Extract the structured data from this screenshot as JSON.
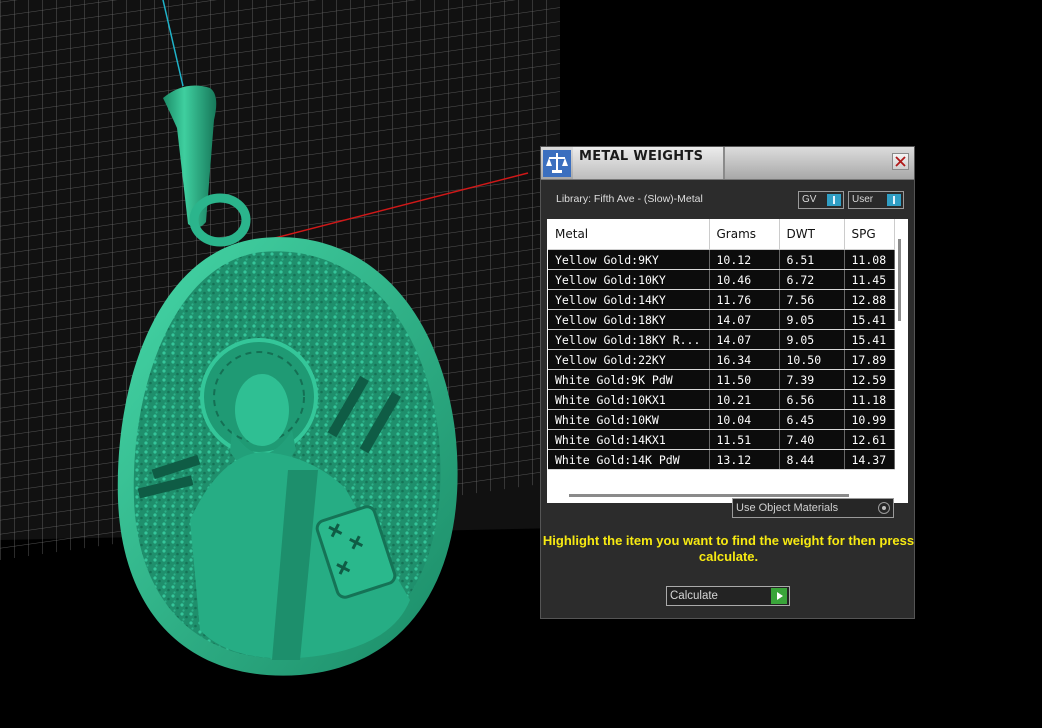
{
  "panel": {
    "title": "METAL WEIGHTS",
    "library_label": "Library: Fifth Ave - (Slow)-Metal",
    "toggles": {
      "gv": "GV",
      "user": "User"
    },
    "use_object_materials": "Use Object Materials",
    "instruction": "Highlight the item you want to find the weight for then press calculate.",
    "calculate": "Calculate"
  },
  "table": {
    "columns": [
      "Metal",
      "Grams",
      "DWT",
      "SPG"
    ],
    "rows": [
      [
        "Yellow Gold:9KY",
        "10.12",
        "6.51",
        "11.08"
      ],
      [
        "Yellow Gold:10KY",
        "10.46",
        "6.72",
        "11.45"
      ],
      [
        "Yellow Gold:14KY",
        "11.76",
        "7.56",
        "12.88"
      ],
      [
        "Yellow Gold:18KY",
        "14.07",
        "9.05",
        "15.41"
      ],
      [
        "Yellow Gold:18KY R...",
        "14.07",
        "9.05",
        "15.41"
      ],
      [
        "Yellow Gold:22KY",
        "16.34",
        "10.50",
        "17.89"
      ],
      [
        "White Gold:9K PdW",
        "11.50",
        "7.39",
        "12.59"
      ],
      [
        "White Gold:10KX1",
        "10.21",
        "6.56",
        "11.18"
      ],
      [
        "White Gold:10KW",
        "10.04",
        "6.45",
        "10.99"
      ],
      [
        "White Gold:14KX1",
        "11.51",
        "7.40",
        "12.61"
      ],
      [
        "White Gold:14K PdW",
        "13.12",
        "8.44",
        "14.37"
      ]
    ]
  },
  "colors": {
    "model": "#2bb58c",
    "instruction": "#f7ea12",
    "toggle_knob": "#2f9ec4",
    "calculate_play": "#3aa53a"
  },
  "icons": {
    "app": "scale-icon",
    "close": "close-icon",
    "calculate": "play-icon"
  }
}
